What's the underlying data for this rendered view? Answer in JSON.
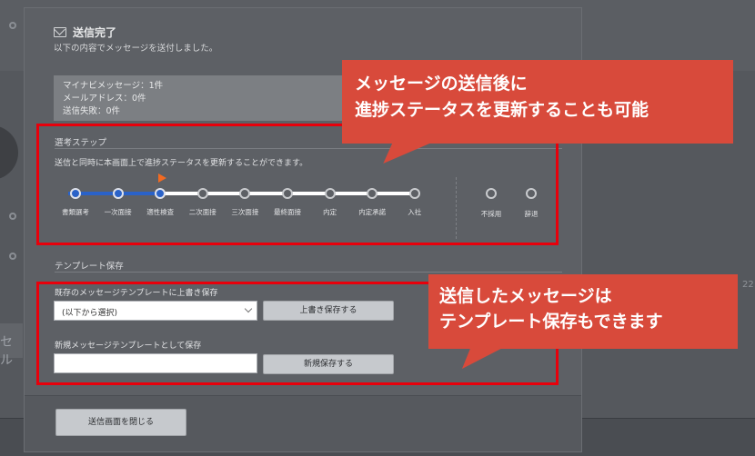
{
  "background": {
    "side_text": "セル",
    "side_number": "22"
  },
  "modal": {
    "title": "送信完了",
    "subtitle": "以下の内容でメッセージを送付しました。",
    "stats": {
      "line1": "マイナビメッセージ：1件",
      "line2": "メールアドレス：0件",
      "line3": "送信失敗：0件"
    },
    "selection": {
      "heading": "選考ステップ",
      "description": "送信と同時に本画面上で進捗ステータスを更新することができます。",
      "current_step_index": 2,
      "steps": [
        {
          "label": "書類選考",
          "completed": true
        },
        {
          "label": "一次面接",
          "completed": true
        },
        {
          "label": "適性検査",
          "completed": true
        },
        {
          "label": "二次面接",
          "completed": false
        },
        {
          "label": "三次面接",
          "completed": false
        },
        {
          "label": "最終面接",
          "completed": false
        },
        {
          "label": "内定",
          "completed": false
        },
        {
          "label": "内定承諾",
          "completed": false
        },
        {
          "label": "入社",
          "completed": false
        }
      ],
      "extra_steps": [
        {
          "label": "不採用"
        },
        {
          "label": "辞退"
        }
      ]
    },
    "template": {
      "heading": "テンプレート保存",
      "overwrite_label": "既存のメッセージテンプレートに上書き保存",
      "select_value": "(以下から選択)",
      "overwrite_button": "上書き保存する",
      "new_label": "新規メッセージテンプレートとして保存",
      "new_input_value": "",
      "new_button": "新規保存する"
    },
    "close_button": "送信画面を閉じる"
  },
  "callouts": {
    "top_line1": "メッセージの送信後に",
    "top_line2": "進捗ステータスを更新することも可能",
    "bottom_line1": "送信したメッセージは",
    "bottom_line2": "テンプレート保存もできます"
  },
  "colors": {
    "highlight": "#e8000b",
    "callout": "#d84a3b",
    "step_active": "#2a62c8",
    "step_marker": "#f26a21"
  }
}
